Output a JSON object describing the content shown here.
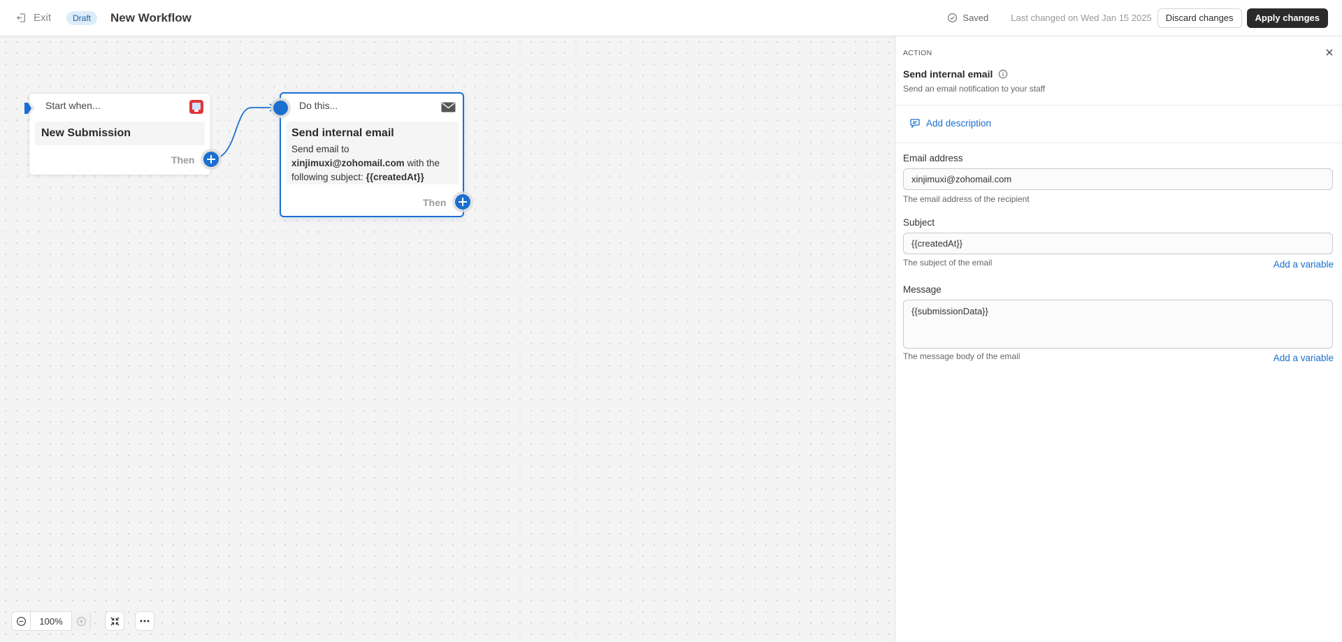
{
  "topbar": {
    "exit_label": "Exit",
    "status_badge": "Draft",
    "title": "New Workflow",
    "saved_label": "Saved",
    "last_changed": "Last changed on Wed Jan 15 2025",
    "discard_label": "Discard changes",
    "apply_label": "Apply changes"
  },
  "canvas": {
    "trigger_node": {
      "header": "Start when...",
      "title": "New Submission",
      "then_label": "Then"
    },
    "action_node": {
      "header": "Do this...",
      "title": "Send internal email",
      "desc_prefix": "Send email to",
      "desc_email": "xinjimuxi@zohomail.com",
      "desc_middle": " with the following subject: ",
      "desc_subject": "{{createdAt}}",
      "then_label": "Then"
    },
    "zoom_level": "100%"
  },
  "panel": {
    "section_label": "ACTION",
    "title": "Send internal email",
    "subtitle": "Send an email notification to your staff",
    "add_description": "Add description",
    "fields": {
      "email": {
        "label": "Email address",
        "value": "xinjimuxi@zohomail.com",
        "help": "The email address of the recipient"
      },
      "subject": {
        "label": "Subject",
        "value": "{{createdAt}}",
        "help": "The subject of the email",
        "link": "Add a variable"
      },
      "message": {
        "label": "Message",
        "value": "{{submissionData}}",
        "help": "The message body of the email",
        "link": "Add a variable"
      }
    }
  },
  "colors": {
    "accent": "#1a6fd0",
    "dark_button": "#2b2b2b",
    "badge_bg": "#dcecfb"
  }
}
